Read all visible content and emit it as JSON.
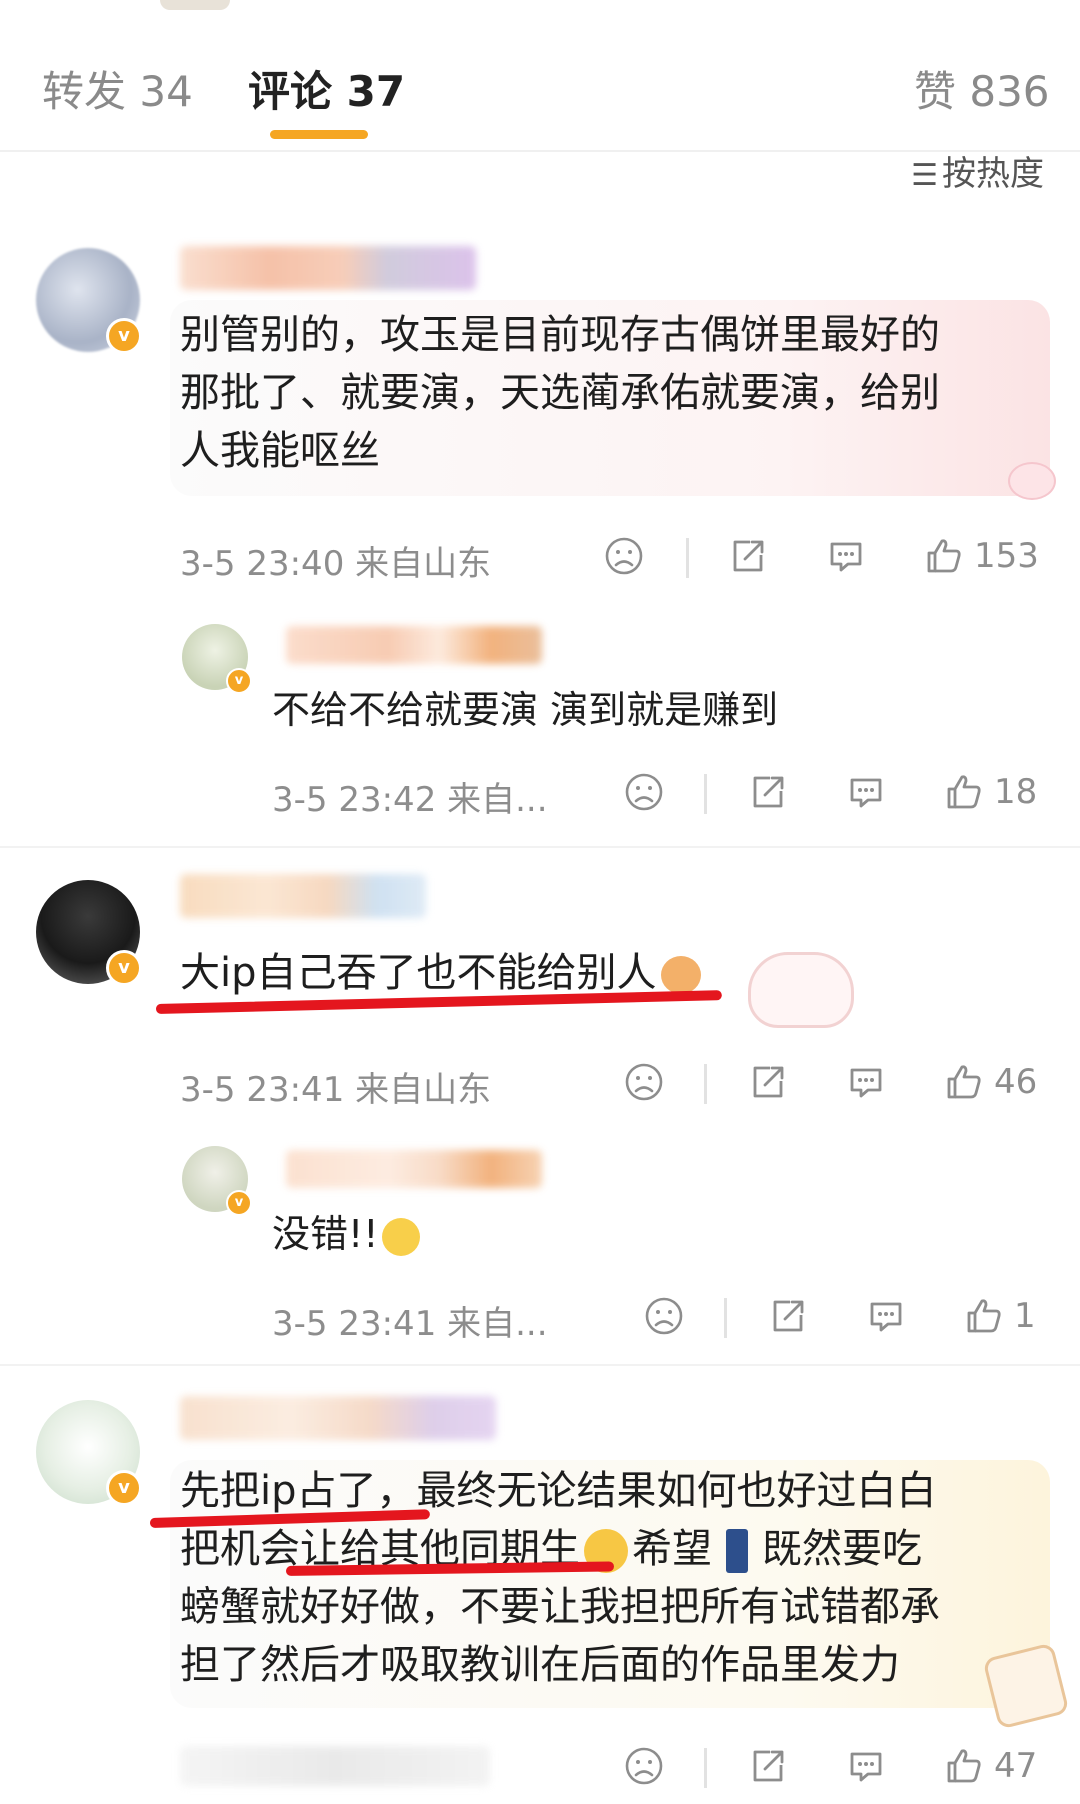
{
  "tabs": {
    "repost": "转发 34",
    "comment": "评论 37",
    "like": "赞 836"
  },
  "sort_label": "按热度",
  "colors": {
    "accent": "#f5a623",
    "highlight_red": "#e4161e",
    "meta_gray": "#8d8d8d"
  },
  "comments": [
    {
      "text_lines": [
        "别管别的，攻玉是目前现存古偶饼里最好的",
        "那批了、就要演，天选蔺承佑就要演，给别",
        "人我能呕丝"
      ],
      "time": "3-5 23:40 来自山东",
      "likes": "153",
      "reply": {
        "text": "不给不给就要演 演到就是赚到",
        "time": "3-5 23:42 来自...",
        "likes": "18"
      }
    },
    {
      "text": "大ip自己吞了也不能给别人",
      "time": "3-5 23:41 来自山东",
      "likes": "46",
      "reply": {
        "text": "没错!!",
        "time": "3-5 23:41 来自...",
        "likes": "1"
      }
    },
    {
      "text_lines": [
        "先把ip占了，最终无论结果如何也好过白白",
        "把机会让给其他同期生",
        "希望",
        "既然要吃",
        "螃蟹就好好做，不要让我担把所有试错都承",
        "担了然后才吸取教训在后面的作品里发力"
      ],
      "likes": "47"
    }
  ],
  "icons": [
    "sad-face-icon",
    "share-icon",
    "comment-icon",
    "thumbs-up-icon",
    "sort-icon",
    "verified-badge-icon",
    "v-icon"
  ],
  "badge_letter": "v"
}
